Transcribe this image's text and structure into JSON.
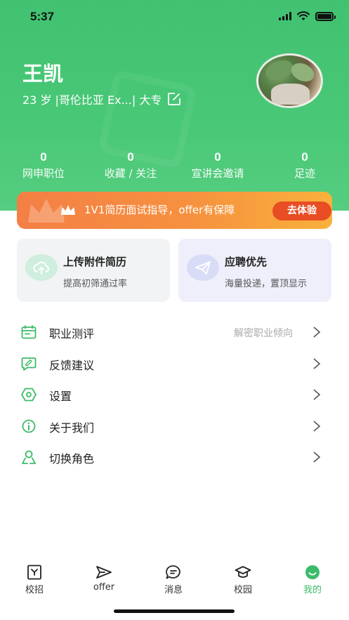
{
  "status_bar": {
    "time": "5:37"
  },
  "profile": {
    "name": "王凯",
    "info": "23 岁 |哥伦比亚 Ex...| 大专"
  },
  "stats": [
    {
      "value": "0",
      "label": "网申职位"
    },
    {
      "value": "0",
      "label": "收藏 / 关注"
    },
    {
      "value": "0",
      "label": "宣讲会邀请"
    },
    {
      "value": "0",
      "label": "足迹"
    }
  ],
  "promo": {
    "text": "1V1简历面试指导，offer有保障",
    "button": "去体验"
  },
  "cards": [
    {
      "title": "上传附件简历",
      "subtitle": "提高初筛通过率",
      "icon": "upload-cloud-icon"
    },
    {
      "title": "应聘优先",
      "subtitle": "海量投递，置顶显示",
      "icon": "paper-plane-icon"
    }
  ],
  "menu": [
    {
      "label": "职业测评",
      "hint": "解密职业倾向",
      "icon": "calendar-icon"
    },
    {
      "label": "反馈建议",
      "hint": "",
      "icon": "feedback-icon"
    },
    {
      "label": "设置",
      "hint": "",
      "icon": "settings-icon"
    },
    {
      "label": "关于我们",
      "hint": "",
      "icon": "info-icon"
    },
    {
      "label": "切换角色",
      "hint": "",
      "icon": "switch-role-icon"
    }
  ],
  "tabbar": [
    {
      "label": "校招",
      "icon": "recruit-icon"
    },
    {
      "label": "offer",
      "icon": "send-icon"
    },
    {
      "label": "消息",
      "icon": "message-icon"
    },
    {
      "label": "校园",
      "icon": "graduation-cap-icon"
    },
    {
      "label": "我的",
      "icon": "profile-icon",
      "active": true
    }
  ],
  "colors": {
    "brand_green": "#41c271",
    "promo_orange": "#f47f45",
    "promo_button": "#e84d24",
    "tab_active": "#3cbb6a"
  }
}
